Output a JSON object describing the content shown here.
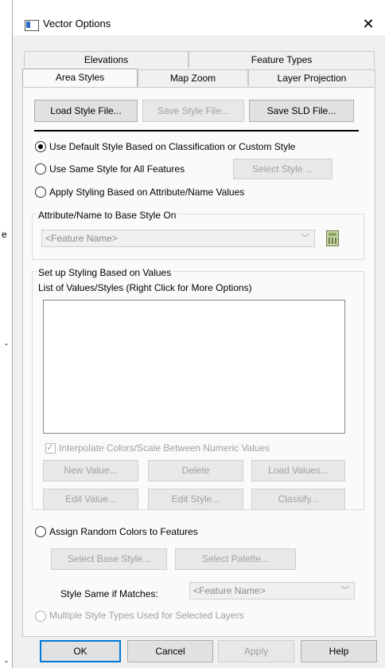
{
  "window": {
    "title": "Vector Options",
    "close_glyph": "✕"
  },
  "edge_marks": [
    "e",
    "-",
    "-"
  ],
  "tabs": {
    "row1": [
      "Elevations",
      "Feature Types"
    ],
    "row2": [
      "Area Styles",
      "Map Zoom",
      "Layer Projection"
    ],
    "active": "Area Styles"
  },
  "style_file_buttons": {
    "load": "Load Style File...",
    "save": "Save Style File...",
    "save_sld": "Save SLD File..."
  },
  "options": {
    "default_style": "Use Default Style Based on Classification or Custom Style",
    "same_style": "Use Same Style for All Features",
    "select_style_btn": "Select Style ...",
    "attribute_styling": "Apply Styling Based on Attribute/Name Values"
  },
  "attribute_group": {
    "label": "Attribute/Name to Base Style On",
    "combo_value": "<Feature Name>"
  },
  "values_group": {
    "label": "Set up Styling Based on Values",
    "list_label": "List of Values/Styles (Right Click for More Options)",
    "interpolate_label": "Interpolate Colors/Scale Between Numeric Values",
    "buttons": [
      "New Value...",
      "Delete",
      "Load Values...",
      "Edit Value...",
      "Edit Style...",
      "Classify..."
    ]
  },
  "random_colors": {
    "label": "Assign Random Colors to Features",
    "select_base_style": "Select Base Style...",
    "select_palette": "Select Palette...",
    "style_same_label": "Style Same if Matches:",
    "combo_value": "<Feature Name>"
  },
  "multiple_styles_label": "Multiple Style Types Used for Selected Layers",
  "footer": {
    "ok": "OK",
    "cancel": "Cancel",
    "apply": "Apply",
    "help": "Help"
  }
}
